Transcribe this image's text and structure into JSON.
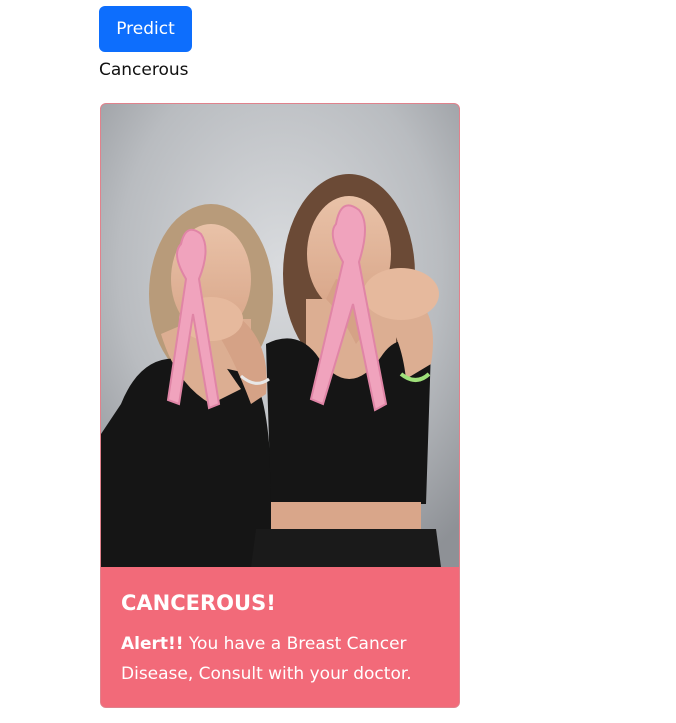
{
  "predict_button": {
    "label": "Predict"
  },
  "result": {
    "text": "Cancerous"
  },
  "card": {
    "image": {
      "icon": "pink-awareness-ribbons-photo",
      "colors": {
        "background": "#c9ccd0",
        "ribbon": "#f4a6c0",
        "clothing": "#141414"
      }
    },
    "title": "CANCEROUS!",
    "alert_label": "Alert!!",
    "message": " You have a Breast Cancer Disease, Consult with your doctor.",
    "colors": {
      "body_background": "#f26a79",
      "border": "#e0828c",
      "text": "#ffffff"
    }
  },
  "colors": {
    "primary_button": "#0d6efd"
  }
}
